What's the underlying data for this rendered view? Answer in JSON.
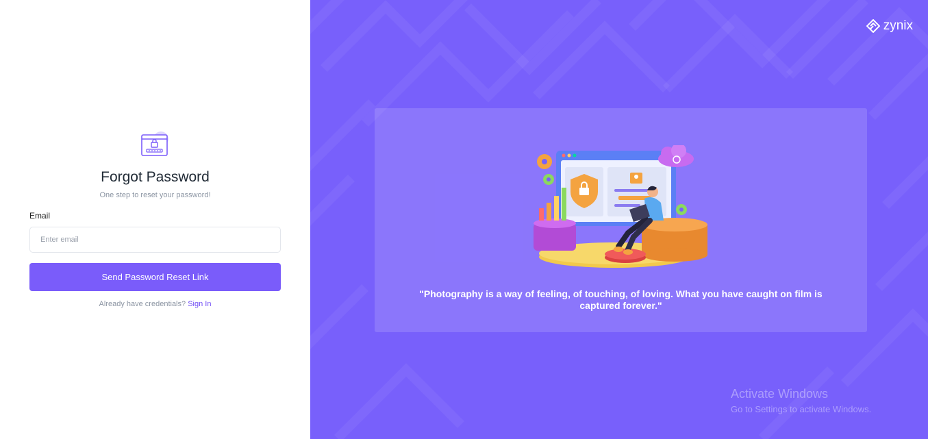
{
  "form": {
    "title": "Forgot Password",
    "subtitle": "One step to reset your password!",
    "email_label": "Email",
    "email_placeholder": "Enter email",
    "email_value": "",
    "submit_label": "Send Password Reset Link",
    "signin_prompt": "Already have credentials?",
    "signin_link": "Sign In",
    "icon": "lock-screen-icon"
  },
  "brand": {
    "name": "zynix",
    "logo_icon": "diamond-logo-icon"
  },
  "showcase": {
    "quote": "\"Photography is a way of feeling, of touching, of loving. What you have caught on film is captured forever.\"",
    "illustration": "security-laptop-illustration"
  },
  "watermark": {
    "title": "Activate Windows",
    "subtitle": "Go to Settings to activate Windows."
  },
  "colors": {
    "accent": "#7a5cfa",
    "panel_bg": "#7860fb",
    "link": "#6f4cf5",
    "heading": "#212b36",
    "muted": "#8c95a3"
  }
}
